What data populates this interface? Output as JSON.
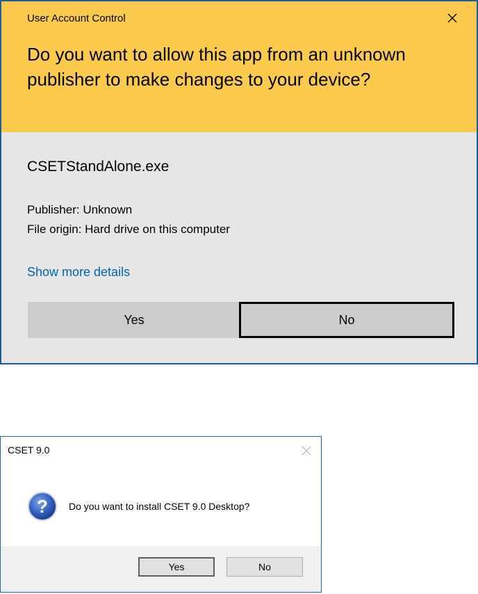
{
  "uac": {
    "window_title": "User Account Control",
    "question": "Do you want to allow this app from an unknown publisher to make changes to your device?",
    "app_name": "CSETStandAlone.exe",
    "publisher": "Publisher: Unknown",
    "file_origin": "File origin: Hard drive on this computer",
    "more_details_link": "Show more details",
    "yes_label": "Yes",
    "no_label": "No",
    "icons": {
      "close": "close-icon"
    },
    "colors": {
      "header": "#fcca4d",
      "body": "#e6e6e6",
      "link": "#0063b1",
      "border": "#1f5d99"
    }
  },
  "cset_dialog": {
    "window_title": "CSET 9.0",
    "message": "Do you want to install CSET 9.0 Desktop?",
    "yes_label": "Yes",
    "no_label": "No",
    "icons": {
      "close": "close-icon",
      "question": "question-icon"
    },
    "colors": {
      "border": "#1a66b3",
      "footer": "#f0f0f0",
      "icon": "#2a55b4"
    }
  }
}
